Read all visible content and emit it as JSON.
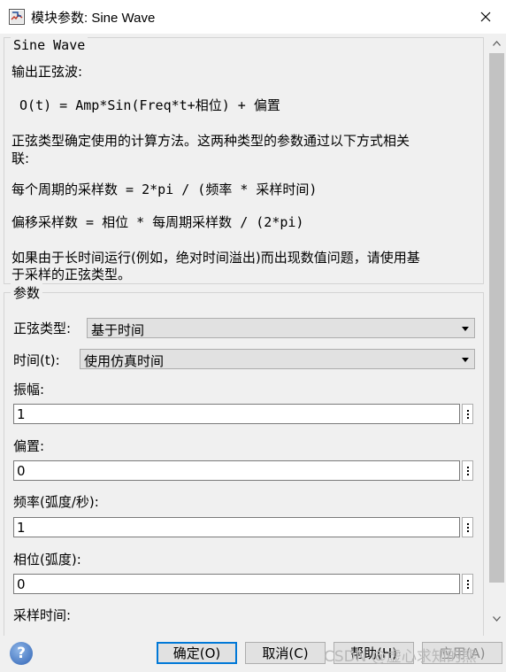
{
  "window": {
    "title": "模块参数: Sine Wave"
  },
  "description": {
    "group_label": "Sine Wave",
    "lines": [
      "输出正弦波:",
      " O(t) = Amp*Sin(Freq*t+相位) + 偏置",
      "正弦类型确定使用的计算方法。这两种类型的参数通过以下方式相关",
      "联:",
      "每个周期的采样数 = 2*pi / (频率 * 采样时间)",
      "偏移采样数 = 相位 * 每周期采样数 / (2*pi)",
      "如果由于长时间运行(例如，绝对时间溢出)而出现数值问题，请使用基",
      "于采样的正弦类型。"
    ]
  },
  "params": {
    "group_label": "参数",
    "sine_type": {
      "label": "正弦类型:",
      "value": "基于时间"
    },
    "time": {
      "label": "时间(t):",
      "value": "使用仿真时间"
    },
    "amplitude": {
      "label": "振幅:",
      "value": "1"
    },
    "bias": {
      "label": "偏置:",
      "value": "0"
    },
    "frequency": {
      "label": "频率(弧度/秒):",
      "value": "1"
    },
    "phase": {
      "label": "相位(弧度):",
      "value": "0"
    },
    "sample_time": {
      "label": "采样时间:"
    }
  },
  "buttons": {
    "ok": "确定(O)",
    "cancel": "取消(C)",
    "help": "帮助(H)",
    "apply": "应用(A)"
  },
  "watermark": "CSDN @虚心求知的熊",
  "colors": {
    "default_button_border": "#0078d7",
    "background": "#f0f0f0"
  },
  "icons": {
    "app": "simulink-block-icon",
    "close": "close-icon",
    "help": "help-icon",
    "scroll_up": "chevron-up-icon",
    "scroll_down": "chevron-down-icon",
    "dropdown": "chevron-down-icon",
    "browse": "vertical-dots-icon"
  }
}
